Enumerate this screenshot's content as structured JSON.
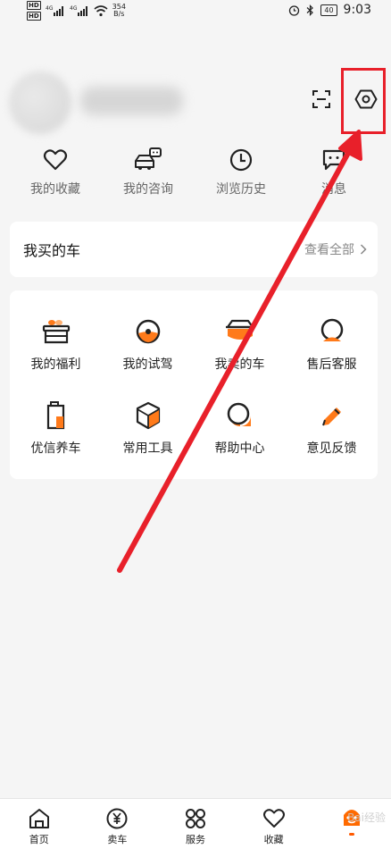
{
  "status_bar": {
    "hd1": "HD",
    "hd2": "HD",
    "net_speed_value": "354",
    "net_speed_unit": "B/s",
    "battery": "40",
    "time": "9:03"
  },
  "profile": {
    "username": "",
    "scan_icon": "scan-icon",
    "settings_icon": "hexagon-settings-icon"
  },
  "quick_links": [
    {
      "label": "我的收藏",
      "icon": "heart-icon"
    },
    {
      "label": "我的咨询",
      "icon": "car-chat-icon"
    },
    {
      "label": "浏览历史",
      "icon": "clock-icon"
    },
    {
      "label": "消息",
      "icon": "message-icon"
    }
  ],
  "my_cars": {
    "title": "我买的车",
    "view_all": "查看全部"
  },
  "services": [
    {
      "label": "我的福利",
      "icon": "gift-basket-icon"
    },
    {
      "label": "我的试驾",
      "icon": "steering-wheel-icon"
    },
    {
      "label": "我卖的车",
      "icon": "car-box-icon"
    },
    {
      "label": "售后客服",
      "icon": "customer-service-icon"
    },
    {
      "label": "优信养车",
      "icon": "oil-can-icon"
    },
    {
      "label": "常用工具",
      "icon": "cube-tool-icon"
    },
    {
      "label": "帮助中心",
      "icon": "help-bubble-icon"
    },
    {
      "label": "意见反馈",
      "icon": "pencil-feedback-icon"
    }
  ],
  "bottom_nav": [
    {
      "label": "首页",
      "icon": "home-icon"
    },
    {
      "label": "卖车",
      "icon": "yen-coin-icon"
    },
    {
      "label": "服务",
      "icon": "grid-services-icon"
    },
    {
      "label": "收藏",
      "icon": "heart-icon"
    },
    {
      "label": "",
      "icon": "profile-face-icon",
      "active": true
    }
  ],
  "watermark": "Bai经验",
  "colors": {
    "accent": "#ff7a1a",
    "annotation_red": "#e8202a",
    "background": "#f5f5f5"
  }
}
